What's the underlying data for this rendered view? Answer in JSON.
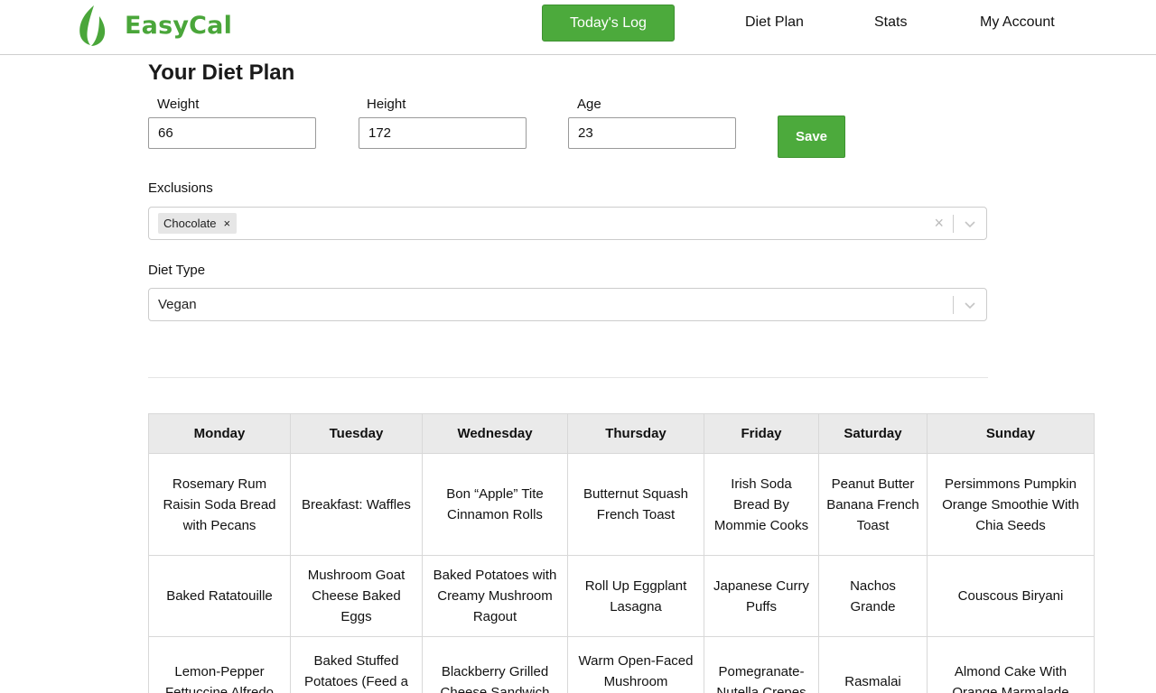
{
  "app": {
    "name": "EasyCal"
  },
  "nav": {
    "todays_log": "Today's Log",
    "diet_plan": "Diet Plan",
    "stats": "Stats",
    "my_account": "My Account"
  },
  "page": {
    "title": "Your Diet Plan"
  },
  "form": {
    "weight_label": "Weight",
    "weight_value": "66",
    "height_label": "Height",
    "height_value": "172",
    "age_label": "Age",
    "age_value": "23",
    "save_label": "Save",
    "exclusions_label": "Exclusions",
    "exclusions": [
      "Chocolate"
    ],
    "diet_type_label": "Diet Type",
    "diet_type_value": "Vegan"
  },
  "icons": {
    "logo": "leaf-flame-icon",
    "clear": "clear-icon",
    "chevron": "chevron-down-icon",
    "remove": "remove-chip-icon"
  },
  "colors": {
    "brand": "#4caa3c"
  },
  "plan": {
    "days": [
      "Monday",
      "Tuesday",
      "Wednesday",
      "Thursday",
      "Friday",
      "Saturday",
      "Sunday"
    ],
    "rows": [
      [
        "Rosemary Rum Raisin Soda Bread with Pecans",
        "Breakfast: Waffles",
        "Bon “Apple” Tite Cinnamon Rolls",
        "Butternut Squash French Toast",
        "Irish Soda Bread By Mommie Cooks",
        "Peanut Butter Banana French Toast",
        "Persimmons Pumpkin Orange Smoothie With Chia Seeds"
      ],
      [
        "Baked Ratatouille",
        "Mushroom Goat Cheese Baked Eggs",
        "Baked Potatoes with Creamy Mushroom Ragout",
        "Roll Up Eggplant Lasagna",
        "Japanese Curry Puffs",
        "Nachos Grande",
        "Couscous Biryani"
      ],
      [
        "Lemon-Pepper Fettuccine Alfredo",
        "Baked Stuffed Potatoes (Feed a Crowd)",
        "Blackberry Grilled Cheese Sandwich",
        "Warm Open-Faced Mushroom Sandwich",
        "Pomegranate-Nutella Crepes",
        "Rasmalai",
        "Almond Cake With Orange Marmalade"
      ]
    ]
  }
}
